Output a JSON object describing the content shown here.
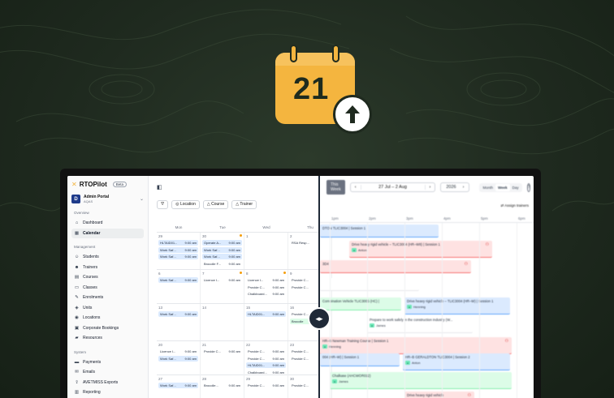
{
  "hero": {
    "calendar_day": "21",
    "icon": "calendar-upload-icon",
    "colors": {
      "calendar": "#f4b53f",
      "background": "#1f2a1f"
    }
  },
  "sidebar": {
    "brand": "RTOPilot",
    "badge": "Beta",
    "account": {
      "name": "Admin Portal",
      "sub": "AQAS"
    },
    "sections": [
      {
        "label": "Overview",
        "items": [
          {
            "label": "Dashboard",
            "icon": "home-icon",
            "glyph": "⌂"
          },
          {
            "label": "Calendar",
            "icon": "calendar-icon",
            "glyph": "▦",
            "active": true
          }
        ]
      },
      {
        "label": "Management",
        "items": [
          {
            "label": "Students",
            "icon": "users-icon",
            "glyph": "☺"
          },
          {
            "label": "Trainers",
            "icon": "trainer-icon",
            "glyph": "☻"
          },
          {
            "label": "Courses",
            "icon": "book-icon",
            "glyph": "▤"
          },
          {
            "label": "Classes",
            "icon": "class-icon",
            "glyph": "▭"
          },
          {
            "label": "Enrolments",
            "icon": "enrol-icon",
            "glyph": "✎"
          },
          {
            "label": "Units",
            "icon": "units-icon",
            "glyph": "◈"
          },
          {
            "label": "Locations",
            "icon": "location-icon",
            "glyph": "◉"
          },
          {
            "label": "Corporate Bookings",
            "icon": "briefcase-icon",
            "glyph": "▣"
          },
          {
            "label": "Resources",
            "icon": "folder-icon",
            "glyph": "▰"
          }
        ]
      },
      {
        "label": "System",
        "items": [
          {
            "label": "Payments",
            "icon": "card-icon",
            "glyph": "▬"
          },
          {
            "label": "Emails",
            "icon": "mail-icon",
            "glyph": "✉"
          },
          {
            "label": "AVETMISS Exports",
            "icon": "export-icon",
            "glyph": "⇪"
          },
          {
            "label": "Reporting",
            "icon": "report-icon",
            "glyph": "▥"
          }
        ]
      }
    ]
  },
  "month": {
    "filters": [
      "Location",
      "Course",
      "Trainer"
    ],
    "days_of_week": [
      "Mon",
      "Tue",
      "Wed",
      "Thu"
    ],
    "weeks": [
      [
        {
          "num": "29",
          "events": [
            {
              "t": "HLTAID01...",
              "time": "9:00 am"
            },
            {
              "t": "Work Saf...",
              "time": "9:00 am"
            },
            {
              "t": "Work Saf...",
              "time": "9:00 am"
            }
          ]
        },
        {
          "num": "30",
          "dot": true,
          "events": [
            {
              "t": "Operate A...",
              "time": "9:00 am"
            },
            {
              "t": "Work Saf...",
              "time": "9:00 am"
            },
            {
              "t": "Work Saf...",
              "time": "9:00 am"
            },
            {
              "t": "Brocolle F...",
              "time": "9:00 am",
              "plain": true
            }
          ]
        },
        {
          "num": "1",
          "events": []
        },
        {
          "num": "2",
          "events": [
            {
              "t": "RSA Resp...",
              "time": "",
              "plain": true
            }
          ]
        }
      ],
      [
        {
          "num": "6",
          "events": [
            {
              "t": "Work Saf...",
              "time": "9:00 am"
            }
          ]
        },
        {
          "num": "7",
          "dot": true,
          "events": [
            {
              "t": "Licence I...",
              "time": "9:00 am",
              "plain": true
            }
          ]
        },
        {
          "num": "8",
          "dot": true,
          "events": [
            {
              "t": "Licence I...",
              "time": "9:00 am",
              "plain": true
            },
            {
              "t": "Provide C...",
              "time": "9:00 am",
              "plain": true
            },
            {
              "t": "Chalkboard...",
              "time": "9:00 am",
              "plain": true
            }
          ]
        },
        {
          "num": "9",
          "events": [
            {
              "t": "Provide C...",
              "time": "",
              "plain": true
            },
            {
              "t": "Provide C...",
              "time": "",
              "plain": true
            }
          ]
        }
      ],
      [
        {
          "num": "13",
          "events": [
            {
              "t": "Work Saf...",
              "time": "9:00 am"
            }
          ]
        },
        {
          "num": "14",
          "events": []
        },
        {
          "num": "15",
          "events": [
            {
              "t": "HLTAID01...",
              "time": "9:00 am"
            }
          ]
        },
        {
          "num": "16",
          "events": [
            {
              "t": "Provide C...",
              "time": "",
              "plain": true
            },
            {
              "t": "Brocolle",
              "time": "",
              "green": true
            }
          ]
        }
      ],
      [
        {
          "num": "20",
          "events": [
            {
              "t": "Licence I...",
              "time": "9:00 am",
              "plain": true
            },
            {
              "t": "Work Saf...",
              "time": "9:00 am"
            }
          ]
        },
        {
          "num": "21",
          "events": [
            {
              "t": "Provide C...",
              "time": "9:00 am",
              "plain": true
            }
          ]
        },
        {
          "num": "22",
          "events": [
            {
              "t": "Provide C...",
              "time": "9:00 am",
              "plain": true
            },
            {
              "t": "Provide C...",
              "time": "9:00 am",
              "plain": true
            },
            {
              "t": "HLTAID01...",
              "time": "9:00 am"
            },
            {
              "t": "Chalkboard...",
              "time": "9:00 am",
              "plain": true
            }
          ]
        },
        {
          "num": "23",
          "events": [
            {
              "t": "Provide C...",
              "time": "",
              "plain": true
            },
            {
              "t": "Provide C...",
              "time": "",
              "plain": true
            }
          ]
        }
      ],
      [
        {
          "num": "27",
          "events": [
            {
              "t": "Work Saf...",
              "time": "9:00 am"
            }
          ]
        },
        {
          "num": "28",
          "events": [
            {
              "t": "Brocolle...",
              "time": "9:00 am",
              "plain": true
            }
          ]
        },
        {
          "num": "29",
          "events": [
            {
              "t": "Provide C...",
              "time": "9:00 am",
              "plain": true
            }
          ]
        },
        {
          "num": "30",
          "events": [
            {
              "t": "Provide C...",
              "time": "",
              "plain": true
            }
          ]
        }
      ]
    ]
  },
  "week": {
    "this_week": "This Week",
    "range": "27 Jul – 2 Aug",
    "year": "2026",
    "views": [
      "Month",
      "Week",
      "Day"
    ],
    "active_view": "Week",
    "assign": "Assign trainers",
    "hours": [
      "1pm",
      "2pm",
      "3pm",
      "4pm",
      "5pm",
      "6pm"
    ],
    "events": [
      {
        "t": "DTON TLIC3004 | Session 1",
        "c": "blue"
      },
      {
        "t": "Drive heavy rigid vehicle – TLIC3004 (HR–W8) | Session 1",
        "c": "red",
        "trainer": "Anton"
      },
      {
        "t": "3D4",
        "c": "red"
      },
      {
        "t": "",
        "c": "white"
      },
      {
        "t": "Combination Vehicle TLIC3005 (HC) |",
        "c": "green"
      },
      {
        "t": "Drive heavy rigid vehicle – TLIC3004 (HR–W) | Session 1",
        "c": "blue",
        "trainer": "Henning"
      },
      {
        "t": "Prepare to work safely in the construction industry (W...",
        "c": "white",
        "trainer": "James"
      },
      {
        "t": "HR–B Newman Training Course | Session 1",
        "c": "red",
        "trainer": "Henning"
      },
      {
        "t": "004 (HR–W) | Session 1",
        "c": "blue"
      },
      {
        "t": "HR–B GERALDTON TLIC3004 | Session 2",
        "c": "blue",
        "trainer": "Anton"
      },
      {
        "t": "Chalkase (AHCWOR012)",
        "c": "green",
        "trainer": "James"
      },
      {
        "t": "Drive heavy rigid vehicle",
        "c": "red"
      }
    ]
  }
}
